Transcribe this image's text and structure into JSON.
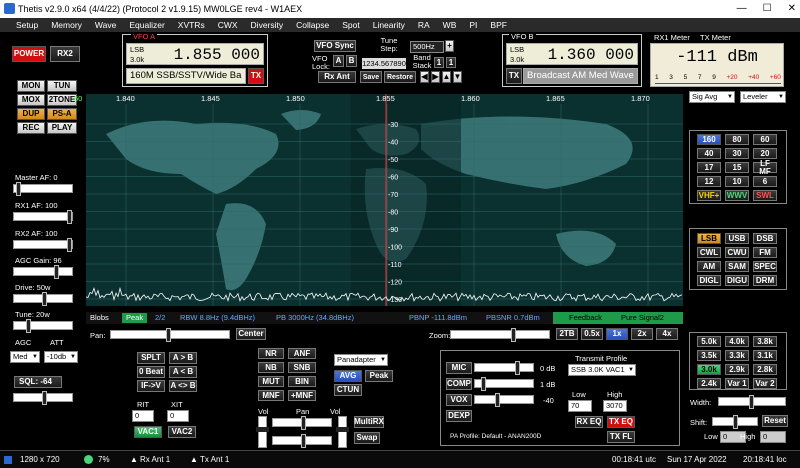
{
  "window": {
    "title": "Thetis v2.9.0 x64 (4/4/22) (Protocol 2 v1.9.15) MW0LGE rev4  -  W1AEX",
    "minimize": "—",
    "maximize": "☐",
    "close": "✕"
  },
  "menu": [
    "Setup",
    "Memory",
    "Wave",
    "Equalizer",
    "XVTRs",
    "CWX",
    "Diversity",
    "Collapse",
    "Spot",
    "Linearity",
    "RA",
    "WB",
    "PI",
    "BPF"
  ],
  "left": {
    "power": "POWER",
    "rx2": "RX2",
    "mon": "MON",
    "tun": "TUN",
    "mox": "MOX",
    "two_tone": "2TONE",
    "dup": "DUP",
    "psa": "PS-A",
    "rec": "REC",
    "play": "PLAY",
    "master_af": "Master AF:  0",
    "rx1_af": "RX1 AF:  100",
    "rx2_af": "RX2 AF:  100",
    "agc_gain": "AGC Gain:  96",
    "drive": "Drive:  50w",
    "tune": "Tune:  20w",
    "agc": "AGC",
    "att": "ATT",
    "agc_val": "Med",
    "att_val": "-10db",
    "sql": "SQL:  -64"
  },
  "vfoa": {
    "title": "VFO A",
    "mode": "LSB",
    "bw": "3.0k",
    "freq": "1.855 000",
    "band": "160M SSB/SSTV/Wide Ba",
    "tx": "TX"
  },
  "vfob": {
    "title": "VFO B",
    "mode": "LSB",
    "bw": "3.0k",
    "freq": "1.360 000",
    "band": "Broadcast AM Med Wave",
    "tx": "TX"
  },
  "mid": {
    "vfo_sync": "VFO Sync",
    "tune_step_label": "Tune Step:",
    "tune_step": "500Hz",
    "vfo_lock": "VFO Lock:",
    "a": "A",
    "b": "B",
    "lock_freq": "1234.567890",
    "band_stack": "Band Stack",
    "band_stack_val": "1",
    "rx_ant": "Rx Ant",
    "save": "Save",
    "restore": "Restore"
  },
  "meters": {
    "rx1": "RX1 Meter",
    "tx": "TX Meter",
    "reading": "-111 dBm",
    "scale": [
      "1",
      "3",
      "5",
      "7",
      "9",
      "+20",
      "+40",
      "+60"
    ],
    "rx_mode": "Sig Avg",
    "tx_mode": "Leveler"
  },
  "spectrum": {
    "top": "60",
    "freqs": [
      "1.840",
      "1.845",
      "1.850",
      "1.855",
      "1.860",
      "1.865",
      "1.870"
    ],
    "db": [
      "-30",
      "-40",
      "-50",
      "-60",
      "-70",
      "-80",
      "-90",
      "-100",
      "-110",
      "-120",
      "-130"
    ],
    "info": {
      "blobs": "Blobs",
      "peak": "Peak",
      "peak_n": "2/2",
      "rbw": "RBW 8.8Hz (9.4dBHz)",
      "pb": "PB 3000Hz (34.8dBHz)",
      "pbnp": "PBNP -111.8dBm",
      "pbsnr": "PBSNR 0.7dBm",
      "feedback": "Feedback",
      "pure_signal": "Pure Signal2"
    },
    "pan": "Pan:",
    "center": "Center",
    "zoom": "Zoom:",
    "z1": "2TB",
    "z2": "0.5x",
    "z3": "1x",
    "z4": "2x",
    "z5": "4x"
  },
  "bands": [
    "160",
    "80",
    "60",
    "40",
    "30",
    "20",
    "17",
    "15",
    "LF MF",
    "12",
    "10",
    "6",
    "VHF+",
    "WWV",
    "SWL"
  ],
  "modes": [
    "LSB",
    "USB",
    "DSB",
    "CWL",
    "CWU",
    "FM",
    "AM",
    "SAM",
    "SPEC",
    "DIGL",
    "DIGU",
    "DRM"
  ],
  "filters": [
    "5.0k",
    "4.0k",
    "3.8k",
    "3.5k",
    "3.3k",
    "3.1k",
    "3.0k",
    "2.9k",
    "2.8k",
    "2.4k",
    "Var 1",
    "Var 2"
  ],
  "filter_ctrl": {
    "width": "Width:",
    "shift": "Shift:",
    "reset": "Reset",
    "low": "Low",
    "high": "High",
    "low_val": "0",
    "high_val": "0"
  },
  "dsp": {
    "splt": "SPLT",
    "ab": "A > B",
    "zero_beat": "0 Beat",
    "ba": "A < B",
    "ifv": "IF->V",
    "swap": "A <> B",
    "rit": "RIT",
    "rit_val": "0",
    "xit": "XIT",
    "xit_val": "0",
    "vac1": "VAC1",
    "vac2": "VAC2",
    "nr": "NR",
    "anf": "ANF",
    "nb": "NB",
    "snb": "SNB",
    "mut": "MUT",
    "bin": "BIN",
    "mnf": "MNF",
    "pmnf": "+MNF",
    "display": "Panadapter",
    "avg": "AVG",
    "peak": "Peak",
    "ctun": "CTUN",
    "vol": "Vol",
    "pan": "Pan",
    "multirx": "MultiRX",
    "swap2": "Swap"
  },
  "tx": {
    "mic": "MIC",
    "mic_db": "0 dB",
    "comp": "COMP",
    "comp_db": "1 dB",
    "vox": "VOX",
    "vox_db": "-40",
    "dexp": "DEXP",
    "profile_label": "Transmit Profile",
    "profile": "SSB 3.0K VAC1",
    "low": "Low",
    "high": "High",
    "low_val": "70",
    "high_val": "3070",
    "rxeq": "RX EQ",
    "txeq": "TX EQ",
    "txfl": "TX FL",
    "pa_profile": "PA Profile: Default - ANAN200D"
  },
  "status": {
    "res": "1280 x 720",
    "cpu": "7%",
    "rxant": "Rx Ant 1",
    "txant": "Tx Ant 1",
    "utc": "00:18:41 utc",
    "date": "Sun 17 Apr 2022",
    "loc": "20:18:41 loc"
  },
  "colors": {
    "spectrum_bg": "#0b3030",
    "trace": "#ffffff",
    "accent_red": "#d01010",
    "accent_green": "#1f9a4a"
  }
}
